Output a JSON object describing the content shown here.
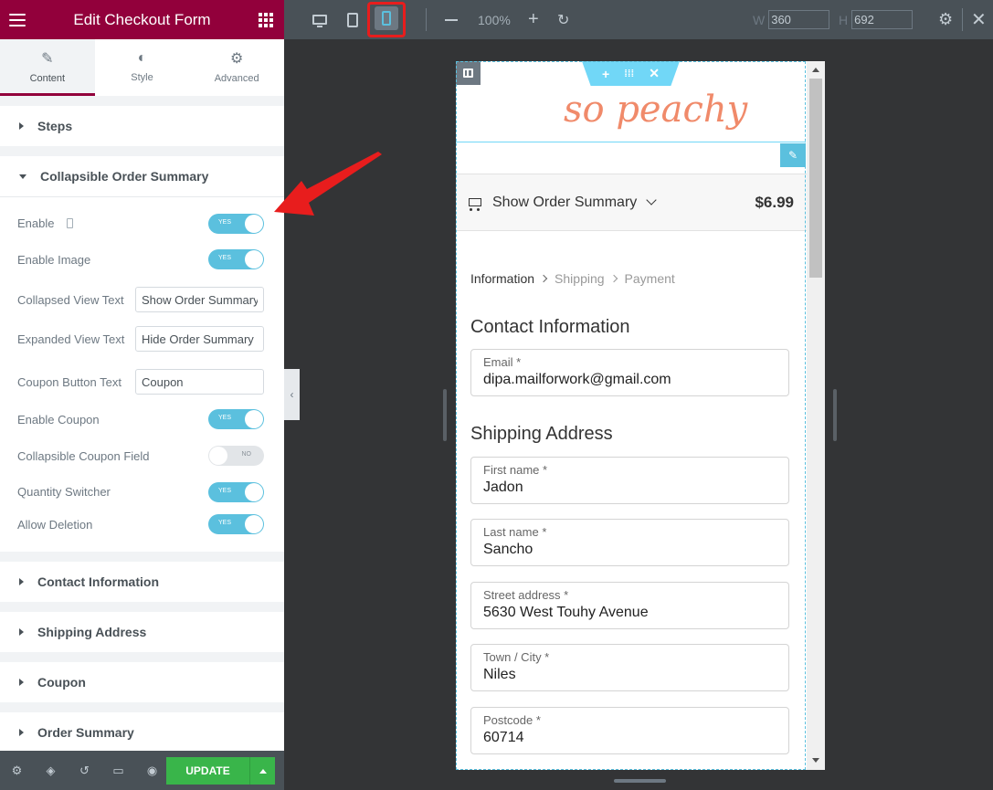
{
  "panel": {
    "title": "Edit Checkout Form",
    "tabs": [
      {
        "label": "Content",
        "icon": "pencil-icon"
      },
      {
        "label": "Style",
        "icon": "half-circle-icon"
      },
      {
        "label": "Advanced",
        "icon": "gear-icon"
      }
    ],
    "sections": {
      "steps": "Steps",
      "collapsible": "Collapsible Order Summary",
      "contact": "Contact Information",
      "shipping": "Shipping Address",
      "coupon": "Coupon",
      "summary": "Order Summary"
    },
    "controls": {
      "enable": {
        "label": "Enable",
        "state": "YES"
      },
      "enable_image": {
        "label": "Enable Image",
        "state": "YES"
      },
      "collapsed_text": {
        "label": "Collapsed View Text",
        "value": "Show Order Summary"
      },
      "expanded_text": {
        "label": "Expanded View Text",
        "value": "Hide Order Summary"
      },
      "coupon_text": {
        "label": "Coupon Button Text",
        "value": "Coupon"
      },
      "enable_coupon": {
        "label": "Enable Coupon",
        "state": "YES"
      },
      "collapsible_coupon": {
        "label": "Collapsible Coupon Field",
        "state": "NO"
      },
      "quantity": {
        "label": "Quantity Switcher",
        "state": "YES"
      },
      "deletion": {
        "label": "Allow Deletion",
        "state": "YES"
      }
    },
    "footer": {
      "update_label": "UPDATE"
    }
  },
  "topbar": {
    "zoom": "100%",
    "width_label": "W",
    "width_value": "360",
    "height_label": "H",
    "height_value": "692"
  },
  "preview": {
    "logo": "so peachy",
    "order_summary": "Show Order Summary",
    "order_total": "$6.99",
    "breadcrumb": [
      "Information",
      "Shipping",
      "Payment"
    ],
    "contact_heading": "Contact Information",
    "shipping_heading": "Shipping Address",
    "fields": [
      {
        "label": "Email *",
        "value": "dipa.mailforwork@gmail.com"
      },
      {
        "label": "First name *",
        "value": "Jadon"
      },
      {
        "label": "Last name *",
        "value": "Sancho"
      },
      {
        "label": "Street address *",
        "value": "5630 West Touhy Avenue"
      },
      {
        "label": "Town / City *",
        "value": "Niles"
      },
      {
        "label": "Postcode *",
        "value": "60714"
      }
    ]
  },
  "colors": {
    "brand": "#92003b",
    "toggle_on": "#5bc0de",
    "update": "#39b54a",
    "highlight": "#e81d1d",
    "logo": "#f08a6a"
  }
}
